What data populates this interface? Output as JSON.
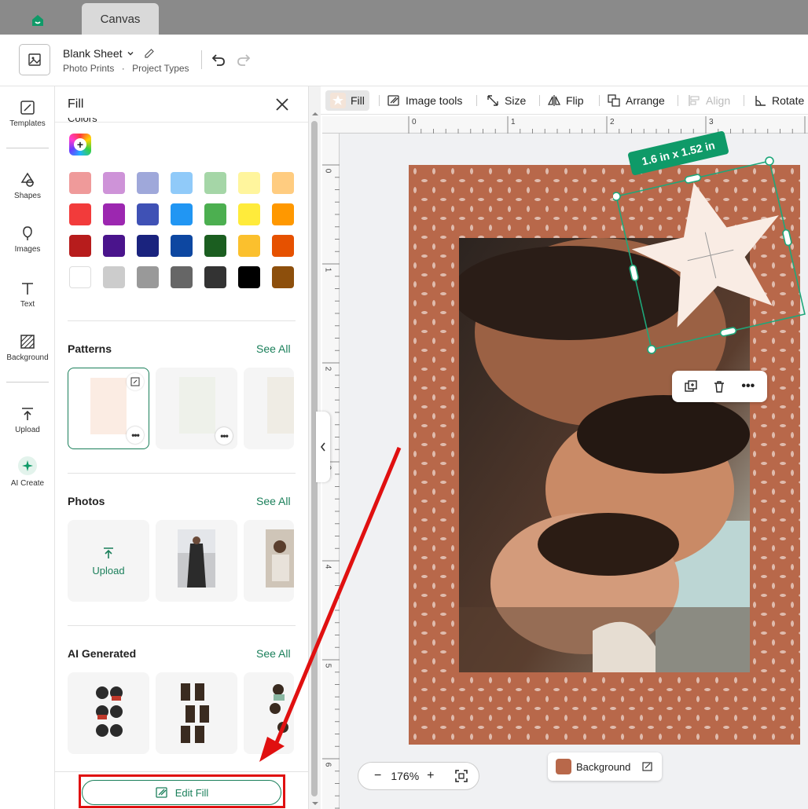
{
  "tabs": {
    "home_icon": "home-icon",
    "canvas_label": "Canvas"
  },
  "header": {
    "doc_title": "Blank Sheet",
    "doc_sub_1": "Photo Prints",
    "doc_sub_sep": "·",
    "doc_sub_2": "Project Types"
  },
  "rail": {
    "templates": "Templates",
    "shapes": "Shapes",
    "images": "Images",
    "text": "Text",
    "background": "Background",
    "upload": "Upload",
    "ai_create": "AI Create"
  },
  "panel": {
    "title": "Fill",
    "colors_label": "Colors",
    "swatches": [
      "#ef9a9a",
      "#ce93d8",
      "#9fa8da",
      "#90caf9",
      "#a5d6a7",
      "#fff59d",
      "#ffcc80",
      "#f23b3b",
      "#9c27b0",
      "#3f51b5",
      "#2196f3",
      "#4caf50",
      "#ffeb3b",
      "#ff9800",
      "#b71c1c",
      "#4a148c",
      "#1a237e",
      "#0d47a1",
      "#1b5e20",
      "#fbc02d",
      "#e65100",
      "#ffffff",
      "#cccccc",
      "#999999",
      "#666666",
      "#333333",
      "#000000",
      "#8d4f0c"
    ],
    "patterns_title": "Patterns",
    "photos_title": "Photos",
    "ai_title": "AI Generated",
    "see_all": "See All",
    "upload_label": "Upload",
    "edit_fill": "Edit Fill"
  },
  "toolbar": {
    "fill": "Fill",
    "image_tools": "Image tools",
    "size": "Size",
    "flip": "Flip",
    "arrange": "Arrange",
    "align": "Align",
    "rotate": "Rotate"
  },
  "rulers": {
    "top": [
      "0",
      "1",
      "2",
      "3"
    ],
    "left": [
      "0",
      "1",
      "2",
      "3",
      "4",
      "5",
      "6"
    ]
  },
  "canvas": {
    "size_badge": "1.6 in x 1.52 in",
    "zoom": "176%",
    "zoom_minus": "−",
    "zoom_plus": "+",
    "background_chip": "Background",
    "accent": "#1a7f5a",
    "page_color": "#b8684a"
  }
}
